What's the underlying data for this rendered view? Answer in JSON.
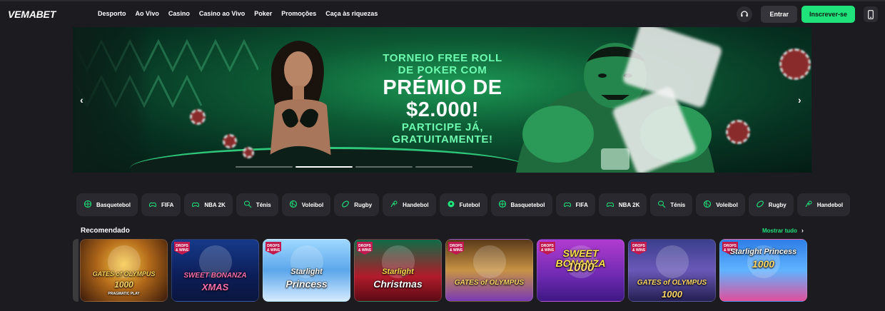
{
  "header": {
    "logo": "VEMABET",
    "nav": [
      "Desporto",
      "Ao Vivo",
      "Casino",
      "Casino ao Vivo",
      "Poker",
      "Promoções",
      "Caça às riquezas"
    ],
    "login_label": "Entrar",
    "signup_label": "Inscrever-se",
    "icons": [
      "headset-icon",
      "mobile-phone-icon"
    ],
    "accent_color": "#1fe37a"
  },
  "banner": {
    "line1": "TORNEIO FREE ROLL",
    "line2": "DE POKER COM",
    "line3": "PRÉMIO DE",
    "line4": "$2.000!",
    "line5": "PARTICIPE JÁ,",
    "line6": "GRATUITAMENTE!",
    "prev_arrow": "‹",
    "next_arrow": "›",
    "slide_count": 4,
    "active_slide": 2
  },
  "sports": [
    {
      "label": "Basquetebol",
      "icon": "basketball-icon"
    },
    {
      "label": "FIFA",
      "icon": "esports-fifa-icon"
    },
    {
      "label": "NBA 2K",
      "icon": "esports-nba-icon"
    },
    {
      "label": "Ténis",
      "icon": "tennis-icon"
    },
    {
      "label": "Voleibol",
      "icon": "volleyball-icon"
    },
    {
      "label": "Rugby",
      "icon": "rugby-icon"
    },
    {
      "label": "Handebol",
      "icon": "handball-icon"
    },
    {
      "label": "Futebol",
      "icon": "football-icon"
    },
    {
      "label": "Basquetebol",
      "icon": "basketball-icon"
    },
    {
      "label": "FIFA",
      "icon": "esports-fifa-icon"
    },
    {
      "label": "NBA 2K",
      "icon": "esports-nba-icon"
    },
    {
      "label": "Ténis",
      "icon": "tennis-icon"
    },
    {
      "label": "Voleibol",
      "icon": "volleyball-icon"
    },
    {
      "label": "Rugby",
      "icon": "rugby-icon"
    },
    {
      "label": "Handebol",
      "icon": "handball-icon"
    }
  ],
  "recommended": {
    "title": "Recomendado",
    "show_all": "Mostrar tudo",
    "games": [
      {
        "title": "GATES of OLYMPUS",
        "sub": "1000",
        "extra": "PRAGMATIC PLAY",
        "badge": ""
      },
      {
        "title": "SWEET BONANZA",
        "sub": "XMAS",
        "extra": "",
        "badge": "DROPS & WINS"
      },
      {
        "title": "Starlight",
        "sub": "Princess",
        "extra": "",
        "badge": "DROPS & WINS"
      },
      {
        "title": "Starlight",
        "sub": "Christmas",
        "extra": "",
        "badge": "DROPS & WINS"
      },
      {
        "title": "GATES of OLYMPUS",
        "sub": "",
        "extra": "",
        "badge": "DROPS & WINS"
      },
      {
        "title": "SWEET BONANZA",
        "sub": "1000",
        "extra": "",
        "badge": "DROPS & WINS"
      },
      {
        "title": "GATES of OLYMPUS",
        "sub": "1000",
        "extra": "",
        "badge": "DROPS & WINS"
      },
      {
        "title": "Starlight Princess",
        "sub": "1000",
        "extra": "",
        "badge": "DROPS & WINS"
      }
    ]
  }
}
